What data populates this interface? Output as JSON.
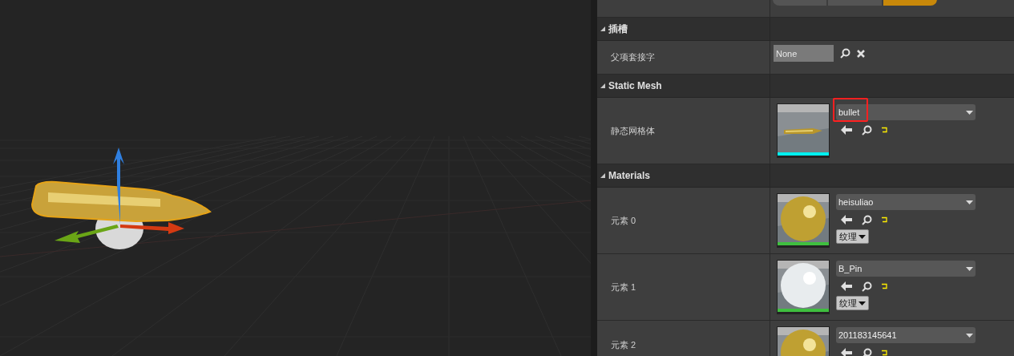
{
  "details": {
    "mobility": [
      {
        "selected": false
      },
      {
        "selected": false
      },
      {
        "selected": true
      }
    ],
    "sections": [
      {
        "title": "插槽",
        "expanded": true,
        "rows": [
          {
            "kind": "name",
            "label": "父项套接字",
            "value": "None"
          }
        ]
      },
      {
        "title": "Static Mesh",
        "expanded": true,
        "rows": [
          {
            "kind": "asset",
            "label": "静态网格体",
            "value": "bullet",
            "thumbnail": {
              "kind": "mesh"
            },
            "highlighted": true
          }
        ]
      },
      {
        "title": "Materials",
        "expanded": true,
        "rows": [
          {
            "kind": "asset",
            "label": "元素 0",
            "value": "heisuliao",
            "thumbnail": {
              "kind": "gold"
            },
            "highlighted": false,
            "texture_button": "纹理"
          },
          {
            "kind": "asset",
            "label": "元素 1",
            "value": "B_Pin",
            "thumbnail": {
              "kind": "white"
            },
            "highlighted": false,
            "texture_button": "纹理"
          },
          {
            "kind": "asset",
            "label": "元素 2",
            "value": "201183145641",
            "thumbnail": {
              "kind": "gold"
            },
            "highlighted": false
          }
        ]
      }
    ]
  }
}
